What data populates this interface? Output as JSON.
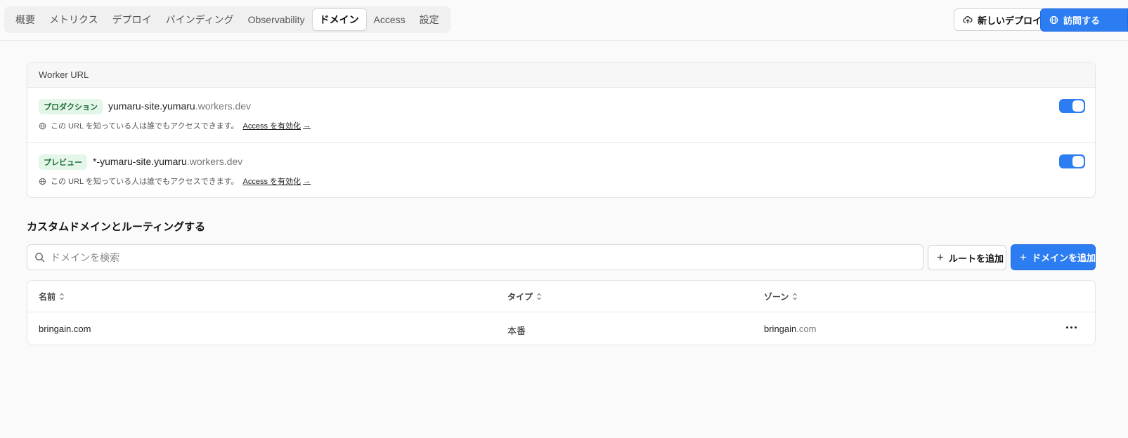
{
  "tabs": [
    {
      "label": "概要"
    },
    {
      "label": "メトリクス"
    },
    {
      "label": "デプロイ"
    },
    {
      "label": "バインディング"
    },
    {
      "label": "Observability"
    },
    {
      "label": "ドメイン",
      "active": true
    },
    {
      "label": "Access"
    },
    {
      "label": "設定"
    }
  ],
  "header": {
    "new_deploy_label": "新しいデプロイ",
    "visit_label": "訪問する"
  },
  "worker_url": {
    "title": "Worker URL",
    "rows": [
      {
        "badge": "プロダクション",
        "url_main": "yumaru-site.yumaru",
        "url_suffix": ".workers.dev",
        "note": "この URL を知っている人は誰でもアクセスできます。",
        "access_link": "Access を有効化",
        "enabled": true
      },
      {
        "badge": "プレビュー",
        "url_main": "*-yumaru-site.yumaru",
        "url_suffix": ".workers.dev",
        "note": "この URL を知っている人は誰でもアクセスできます。",
        "access_link": "Access を有効化",
        "enabled": true
      }
    ]
  },
  "custom_domains": {
    "title": "カスタムドメインとルーティングする",
    "search_placeholder": "ドメインを検索",
    "add_route_label": "ルートを追加",
    "add_domain_label": "ドメインを追加",
    "columns": [
      "名前",
      "タイプ",
      "ゾーン"
    ],
    "rows": [
      {
        "name": "bringain.com",
        "type": "本番",
        "zone_main": "bringain",
        "zone_suffix": ".com"
      }
    ]
  },
  "colors": {
    "accent": "#2c7cf2",
    "badge_bg": "#e3f6e8",
    "badge_text": "#1c6b34"
  }
}
